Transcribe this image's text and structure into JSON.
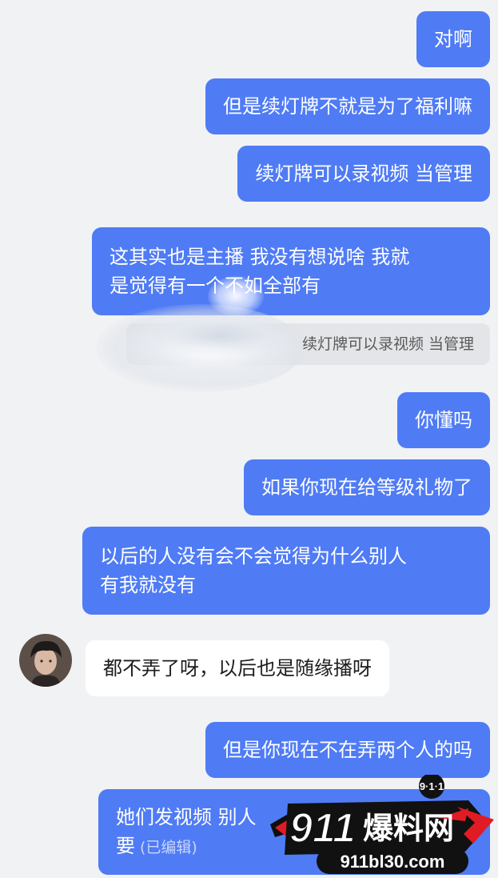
{
  "messages": [
    {
      "text": "对啊"
    },
    {
      "text": "但是续灯牌不就是为了福利嘛"
    },
    {
      "text": "续灯牌可以录视频 当管理"
    },
    {
      "line1": "这其实也是主播 我没有想说啥 我就",
      "line2": "是觉得有一个不如全部有"
    },
    {
      "quote": "续灯牌可以录视频 当管理"
    },
    {
      "text": "你懂吗"
    },
    {
      "text": "如果你现在给等级礼物了"
    },
    {
      "line1": "以后的人没有会不会觉得为什么别人",
      "line2": "有我就没有"
    },
    {
      "text": "都不弄了呀，以后也是随缘播呀"
    },
    {
      "text": "但是你现在不在弄两个人的吗"
    },
    {
      "line1": "她们发视频 别人",
      "line2": "要",
      "edited": "(已编辑)"
    }
  ],
  "watermark": {
    "badge": "9·1·1",
    "brand_num": "911",
    "brand_cn": "爆料网",
    "url": "911bl30.com"
  },
  "colors": {
    "outgoing": "#4f7bf5",
    "incoming": "#ffffff",
    "background": "#f1f2f4"
  }
}
